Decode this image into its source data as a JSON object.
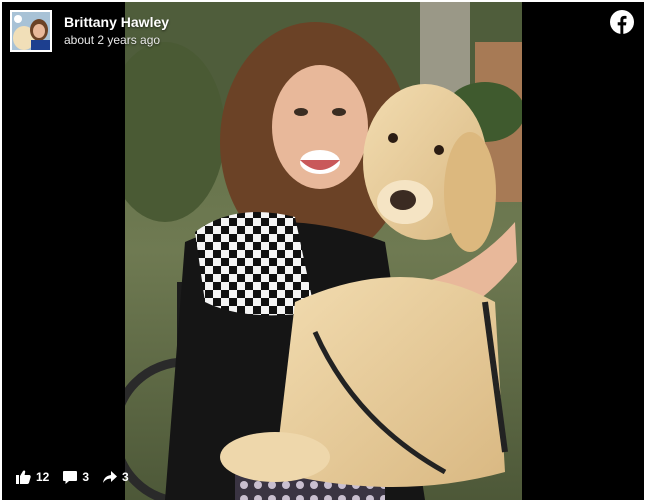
{
  "post": {
    "author": "Brittany Hawley",
    "timestamp": "about 2 years ago"
  },
  "stats": {
    "likes": "12",
    "comments": "3",
    "shares": "3"
  },
  "icons": {
    "brand": "facebook-icon",
    "like": "thumbs-up-icon",
    "comment": "comment-icon",
    "share": "share-arrow-icon"
  },
  "colors": {
    "background": "#000000",
    "text": "#ffffff",
    "brand": "#ffffff"
  }
}
